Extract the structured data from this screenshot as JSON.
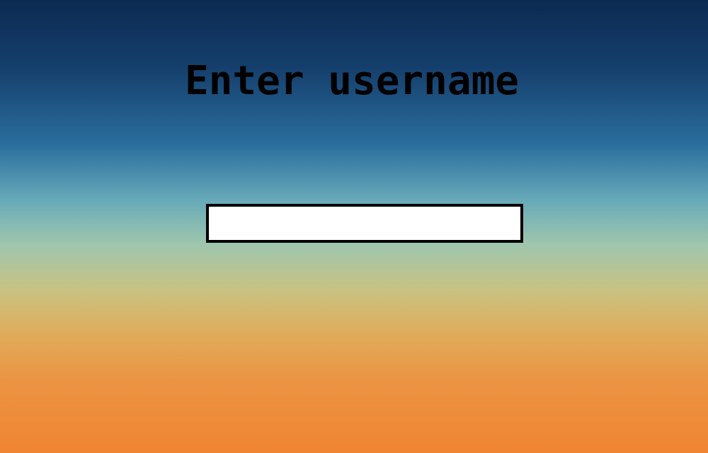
{
  "login": {
    "prompt": "Enter username",
    "username_value": "",
    "username_placeholder": ""
  },
  "colors": {
    "gradient_top": "#0b2a52",
    "gradient_mid": "#9fc6ad",
    "gradient_bottom": "#f08533",
    "input_background": "#ffffff",
    "input_border": "#000000",
    "text": "#000000"
  }
}
